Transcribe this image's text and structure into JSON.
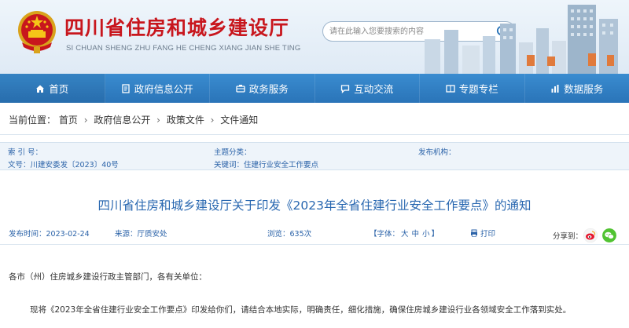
{
  "header": {
    "site_title": "四川省住房和城乡建设厅",
    "site_pinyin": "SI CHUAN SHENG ZHU FANG HE CHENG XIANG JIAN SHE TING",
    "search_placeholder": "请在此输入您要搜索的内容"
  },
  "nav": {
    "items": [
      {
        "label": "首页",
        "icon": "home-icon"
      },
      {
        "label": "政府信息公开",
        "icon": "document-icon"
      },
      {
        "label": "政务服务",
        "icon": "service-icon"
      },
      {
        "label": "互动交流",
        "icon": "chat-icon"
      },
      {
        "label": "专题专栏",
        "icon": "topic-icon"
      },
      {
        "label": "数据服务",
        "icon": "data-icon"
      }
    ]
  },
  "breadcrumb": {
    "prefix": "当前位置：",
    "items": [
      "首页",
      "政府信息公开",
      "政策文件",
      "文件通知"
    ],
    "separator": "›"
  },
  "meta": {
    "index_label": "索 引 号：",
    "index_value": "",
    "topic_label": "主题分类：",
    "topic_value": "",
    "org_label": "发布机构：",
    "org_value": "",
    "doc_label": "文号：",
    "doc_value": "川建安委发〔2023〕40号",
    "keyword_label": "关键词：",
    "keyword_value": "住建行业安全工作要点"
  },
  "article": {
    "title": "四川省住房和城乡建设厅关于印发《2023年全省住建行业安全工作要点》的通知",
    "date_label": "发布时间：",
    "date": "2023-02-24",
    "source_label": "来源：",
    "source": "厅质安处",
    "views_label": "浏览：",
    "views": "635次",
    "font_prefix": "【字体：",
    "font_large": "大",
    "font_medium": "中",
    "font_small": "小",
    "font_suffix": "】",
    "print_label": "打印",
    "share_label": "分享到：",
    "greeting": "各市（州）住房城乡建设行政主管部门，各有关单位：",
    "paragraph1": "现将《2023年全省住建行业安全工作要点》印发给你们，请结合本地实际，明确责任，细化措施，确保住房城乡建设行业各领域安全工作落到实处。"
  },
  "colors": {
    "brand_red": "#c8161d",
    "nav_blue": "#2a74b8",
    "link_blue": "#2a62a8",
    "title_blue": "#2867b0",
    "weibo": "#e6162d",
    "wechat": "#51c332"
  }
}
